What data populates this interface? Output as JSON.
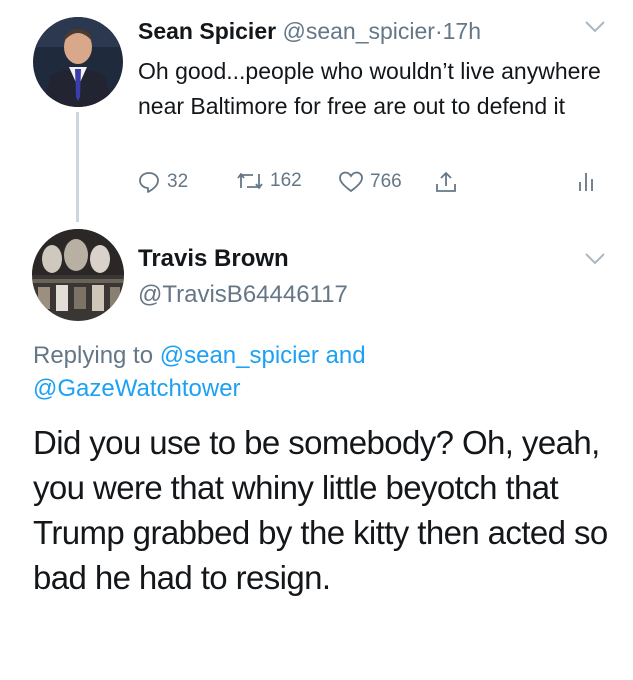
{
  "parent_tweet": {
    "display_name": "Sean Spicier",
    "handle": "@sean_spicier",
    "separator": "·",
    "time": "17h",
    "text": "Oh good...people who wouldn’t live anywhere near Baltimore for free are out to defend it",
    "reply_count": "32",
    "retweet_count": "162",
    "like_count": "766",
    "icons": [
      "reply-icon",
      "retweet-icon",
      "like-icon",
      "share-icon",
      "analytics-icon",
      "chevron-down-icon"
    ]
  },
  "reply_tweet": {
    "display_name": "Travis Brown",
    "handle": "@TravisB64446117",
    "replying_prefix": "Replying to",
    "replying_to_1": "@sean_spicier",
    "replying_and": "and",
    "replying_to_2": "@GazeWatchtower",
    "text": "Did you use to be somebody? Oh, yeah, you were that whiny little beyotch that Trump grabbed by the kitty then acted so bad he had to resign."
  },
  "colors": {
    "text": "#14171a",
    "muted": "#657786",
    "link": "#1da1f2",
    "thread_line": "#ccd6dd",
    "chevron": "#aab8c2"
  }
}
